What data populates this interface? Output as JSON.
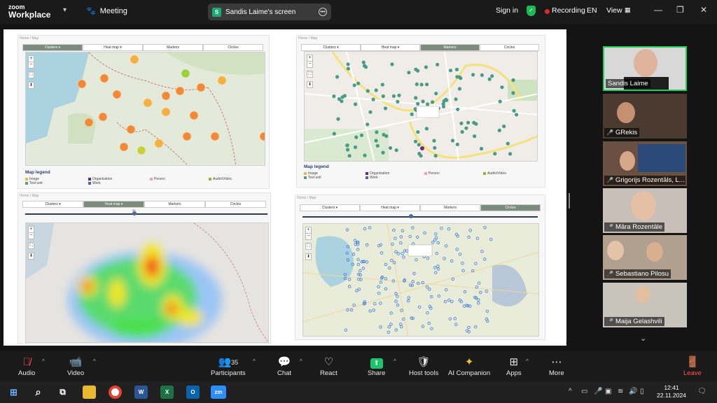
{
  "app": {
    "logo_line1": "zoom",
    "logo_line2": "Workplace",
    "meeting_label": "Meeting",
    "share_badge": "S",
    "share_label": "Sandis Laime's screen",
    "signin": "Sign in",
    "recording": "Recording",
    "language": "EN",
    "view": "View"
  },
  "screen": {
    "panels": [
      {
        "crumb": "Home  /  Map",
        "tabs": [
          "Clusters ▾",
          "Heat map ▾",
          "Markers",
          "Circles"
        ],
        "active_tab": 0,
        "legend_title": "Map legend",
        "legend": [
          {
            "label": "Image",
            "color": "#e8b84a"
          },
          {
            "label": "Text unit",
            "color": "#5a9a8a"
          },
          {
            "label": "Organisation",
            "color": "#6a2a7a"
          },
          {
            "label": "Work",
            "color": "#4a6a9a"
          },
          {
            "label": "Person",
            "color": "#f0a0b0"
          },
          {
            "label": "Audio/Video",
            "color": "#a0b030"
          }
        ]
      },
      {
        "crumb": "Home  /  Map",
        "tabs": [
          "Clusters ▾",
          "Heat map ▾",
          "Markers",
          "Circles"
        ],
        "active_tab": 2,
        "legend_title": "Map legend",
        "legend": [
          {
            "label": "Image",
            "color": "#e8b84a"
          },
          {
            "label": "Text unit",
            "color": "#5a9a8a"
          },
          {
            "label": "Organisation",
            "color": "#6a2a7a"
          },
          {
            "label": "Work",
            "color": "#4a6a9a"
          },
          {
            "label": "Person",
            "color": "#f0a0b0"
          },
          {
            "label": "Audio/Video",
            "color": "#a0b030"
          }
        ]
      },
      {
        "crumb": "Home  /  Map",
        "tabs": [
          "Clusters ▾",
          "Heat map ▾",
          "Markers",
          "Circles"
        ],
        "active_tab": 1,
        "slider_label": "20"
      },
      {
        "crumb": "Home  /  Map",
        "tabs": [
          "Clusters ▾",
          "Heat map ▾",
          "Markers",
          "Circles"
        ],
        "active_tab": 3
      }
    ]
  },
  "participants": [
    {
      "name": "Sandis Laime",
      "muted": false,
      "active": true
    },
    {
      "name": "GRekis",
      "muted": true,
      "active": false
    },
    {
      "name": "Grigorijs Rozentāls, L...",
      "muted": true,
      "active": false
    },
    {
      "name": "Māra Rozentāle",
      "muted": true,
      "active": false
    },
    {
      "name": "Sebastiano Pilosu",
      "muted": true,
      "active": false
    },
    {
      "name": "Maija Gelashvili",
      "muted": true,
      "active": false
    }
  ],
  "toolbar": {
    "audio": "Audio",
    "video": "Video",
    "participants": "Participants",
    "participants_count": "35",
    "chat": "Chat",
    "react": "React",
    "share": "Share",
    "host_tools": "Host tools",
    "ai_companion": "AI Companion",
    "apps": "Apps",
    "more": "More",
    "leave": "Leave"
  },
  "taskbar": {
    "time": "12:41",
    "date": "22.11.2024",
    "apps": [
      "W",
      "X",
      "O",
      "zm"
    ]
  },
  "colors": {
    "accent_green": "#21d05b",
    "recording_red": "#e02828",
    "share_green": "#19a974",
    "leave_red": "#ff5050"
  }
}
